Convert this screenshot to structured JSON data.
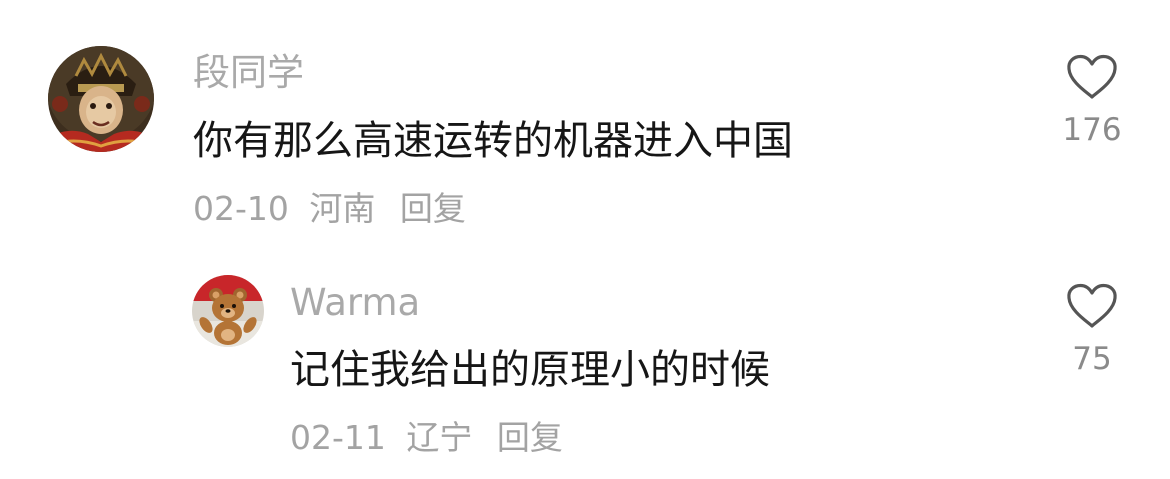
{
  "comments": [
    {
      "username": "段同学",
      "text": "你有那么高速运转的机器进入中国",
      "date": "02-10",
      "location": "河南",
      "reply_label": "回复",
      "likes": "176",
      "avatar_icon": "monkey-king-avatar-icon"
    },
    {
      "username": "Warma",
      "text": "记住我给出的原理小的时候",
      "date": "02-11",
      "location": "辽宁",
      "reply_label": "回复",
      "likes": "75",
      "avatar_icon": "teddy-bear-avatar-icon"
    }
  ],
  "colors": {
    "username": "#a9a9a9",
    "text": "#161616",
    "meta": "#a3a3a3",
    "like_icon": "#555555"
  }
}
